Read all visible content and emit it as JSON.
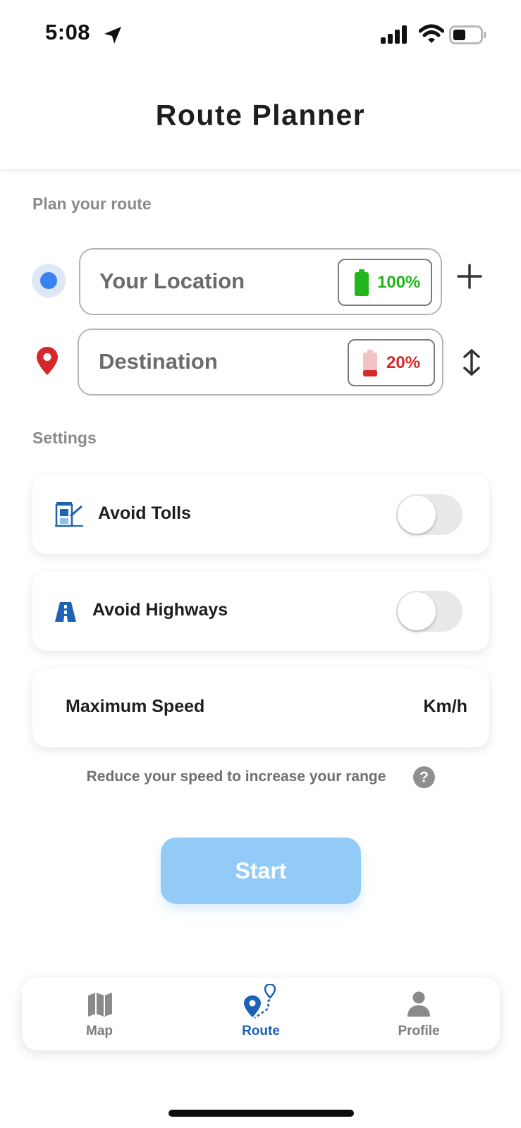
{
  "status_bar": {
    "time": "5:08"
  },
  "header": {
    "title": "Route Planner"
  },
  "plan": {
    "section_label": "Plan your route",
    "origin": {
      "placeholder": "Your Location",
      "battery_pct": "100%",
      "battery_color": "#22b61c",
      "battery_level": 1.0
    },
    "destination": {
      "placeholder": "Destination",
      "battery_pct": "20%",
      "battery_color": "#d42a2a",
      "battery_level": 0.2
    }
  },
  "settings": {
    "section_label": "Settings",
    "avoid_tolls": {
      "label": "Avoid Tolls",
      "enabled": false
    },
    "avoid_highways": {
      "label": "Avoid Highways",
      "enabled": false
    },
    "max_speed": {
      "label": "Maximum Speed",
      "unit": "Km/h"
    },
    "hint": "Reduce your speed to increase your range",
    "help_symbol": "?"
  },
  "start_button": {
    "label": "Start"
  },
  "nav": {
    "items": [
      {
        "label": "Map",
        "icon": "map-icon",
        "active": false
      },
      {
        "label": "Route",
        "icon": "route-icon",
        "active": true
      },
      {
        "label": "Profile",
        "icon": "profile-icon",
        "active": false
      }
    ],
    "active_color": "#1d62b5",
    "inactive_color": "#7b7b7b"
  }
}
